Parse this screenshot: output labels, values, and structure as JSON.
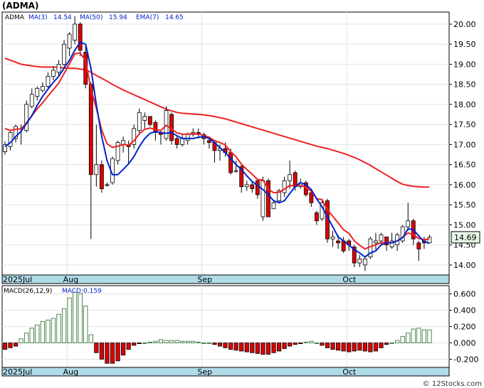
{
  "title": "(ADMA)",
  "watermark": "© 12Stocks.com",
  "price_panel": {
    "legend": {
      "symbol": "ADMA",
      "ma3_label": "MA(3)",
      "ma3_value": "14.54",
      "ma50_label": "MA(50)",
      "ma50_value": "15.94",
      "ema7_label": "EMA(7)",
      "ema7_value": "14.65"
    },
    "last_price_label": "14.69",
    "y_ticks": [
      "20.00",
      "19.50",
      "19.00",
      "18.50",
      "18.00",
      "17.50",
      "17.00",
      "16.50",
      "16.00",
      "15.50",
      "15.00",
      "14.50",
      "14.00"
    ],
    "x_labels": [
      "2025Jul",
      "Aug",
      "Sep",
      "Oct"
    ]
  },
  "macd_panel": {
    "legend": {
      "label": "MACD(26,12,9)",
      "value_label": "MACD:0.159"
    },
    "y_ticks": [
      "0.600",
      "0.400",
      "0.200",
      "0.000",
      "-0.200"
    ],
    "x_labels": [
      "2025Jul",
      "Aug",
      "Sep",
      "Oct"
    ]
  },
  "colors": {
    "up_candle": "#ffffff",
    "down_candle": "#dd0000",
    "ma_short": "#0022cc",
    "ma_long": "#ee2222",
    "macd_pos": "#ffffff",
    "macd_neg": "#dd0000",
    "axis_band": "#b0dbe8",
    "frame": "#000000"
  },
  "chart_data": [
    {
      "type": "candlestick",
      "ylim": [
        13.75,
        20.3
      ],
      "x_months": [
        "2025Jul",
        "Aug",
        "Sep",
        "Oct"
      ],
      "candles": [
        [
          16.82,
          17.0,
          16.75,
          17.08
        ],
        [
          16.95,
          17.3,
          16.85,
          17.35
        ],
        [
          17.15,
          17.45,
          17.05,
          17.5
        ],
        [
          17.4,
          17.4,
          17.0,
          17.5
        ],
        [
          17.35,
          18.0,
          17.3,
          18.1
        ],
        [
          17.95,
          18.25,
          17.9,
          18.4
        ],
        [
          18.2,
          18.4,
          18.1,
          18.45
        ],
        [
          18.35,
          18.45,
          18.3,
          18.55
        ],
        [
          18.45,
          18.7,
          18.4,
          18.8
        ],
        [
          18.7,
          18.85,
          18.6,
          18.95
        ],
        [
          18.8,
          19.0,
          18.7,
          19.1
        ],
        [
          19.0,
          19.5,
          18.95,
          19.6
        ],
        [
          19.4,
          19.75,
          19.2,
          19.8
        ],
        [
          19.6,
          20.0,
          19.5,
          20.2
        ],
        [
          20.0,
          19.35,
          19.2,
          20.05
        ],
        [
          19.3,
          18.5,
          18.4,
          19.5
        ],
        [
          18.5,
          16.25,
          14.65,
          18.55
        ],
        [
          16.25,
          16.5,
          15.95,
          17.5
        ],
        [
          16.5,
          15.9,
          15.8,
          16.6
        ],
        [
          16.0,
          16.0,
          15.95,
          16.05
        ],
        [
          16.05,
          16.65,
          16.0,
          16.7
        ],
        [
          16.6,
          17.05,
          16.5,
          17.1
        ],
        [
          17.0,
          17.1,
          16.8,
          17.2
        ],
        [
          17.0,
          16.95,
          16.5,
          17.1
        ],
        [
          17.0,
          17.4,
          16.9,
          17.5
        ],
        [
          17.35,
          17.8,
          17.25,
          17.9
        ],
        [
          17.6,
          17.7,
          17.4,
          17.8
        ],
        [
          17.7,
          17.5,
          17.45,
          17.6
        ],
        [
          17.55,
          17.3,
          17.1,
          17.6
        ],
        [
          17.3,
          17.25,
          17.0,
          17.35
        ],
        [
          17.15,
          17.85,
          17.1,
          17.95
        ],
        [
          17.75,
          17.1,
          17.0,
          17.8
        ],
        [
          17.15,
          17.0,
          16.9,
          17.2
        ],
        [
          17.0,
          17.15,
          16.95,
          17.25
        ],
        [
          17.1,
          17.25,
          17.0,
          17.3
        ],
        [
          17.25,
          17.3,
          17.2,
          17.4
        ],
        [
          17.3,
          17.25,
          17.15,
          17.4
        ],
        [
          17.25,
          17.15,
          17.0,
          17.3
        ],
        [
          17.1,
          17.05,
          16.9,
          17.2
        ],
        [
          17.05,
          16.85,
          16.55,
          17.1
        ],
        [
          16.85,
          16.9,
          16.6,
          17.0
        ],
        [
          16.9,
          16.8,
          16.7,
          17.05
        ],
        [
          16.8,
          16.3,
          16.25,
          16.9
        ],
        [
          16.35,
          16.35,
          16.3,
          16.6
        ],
        [
          16.45,
          15.95,
          15.8,
          16.5
        ],
        [
          15.95,
          16.0,
          15.85,
          16.1
        ],
        [
          16.0,
          15.9,
          15.8,
          16.1
        ],
        [
          16.1,
          15.75,
          15.65,
          16.15
        ],
        [
          15.2,
          16.1,
          15.1,
          16.2
        ],
        [
          16.1,
          15.2,
          15.2,
          16.15
        ],
        [
          15.4,
          15.55,
          15.4,
          15.6
        ],
        [
          15.6,
          15.85,
          15.55,
          15.9
        ],
        [
          15.8,
          16.1,
          15.7,
          16.2
        ],
        [
          16.1,
          16.25,
          15.9,
          16.6
        ],
        [
          16.3,
          15.95,
          15.85,
          16.35
        ],
        [
          15.95,
          16.05,
          15.9,
          16.15
        ],
        [
          16.05,
          15.75,
          15.7,
          16.1
        ],
        [
          15.8,
          15.55,
          15.45,
          15.9
        ],
        [
          15.3,
          15.1,
          15.0,
          15.35
        ],
        [
          15.15,
          15.55,
          15.1,
          15.65
        ],
        [
          15.6,
          14.65,
          14.55,
          15.65
        ],
        [
          14.65,
          14.7,
          14.45,
          14.85
        ],
        [
          14.6,
          14.55,
          14.4,
          14.75
        ],
        [
          14.6,
          14.35,
          14.3,
          14.7
        ],
        [
          14.6,
          14.5,
          14.35,
          14.65
        ],
        [
          14.45,
          14.05,
          13.95,
          14.5
        ],
        [
          14.05,
          14.15,
          13.95,
          14.25
        ],
        [
          14.0,
          14.15,
          13.85,
          14.2
        ],
        [
          14.2,
          14.65,
          14.15,
          14.7
        ],
        [
          14.55,
          14.6,
          14.35,
          14.8
        ],
        [
          14.6,
          14.75,
          14.5,
          14.8
        ],
        [
          14.7,
          14.5,
          14.35,
          14.7
        ],
        [
          14.45,
          14.6,
          14.4,
          14.8
        ],
        [
          14.5,
          14.75,
          14.35,
          14.8
        ],
        [
          14.6,
          14.95,
          14.55,
          15.0
        ],
        [
          14.95,
          15.1,
          14.85,
          15.55
        ],
        [
          15.1,
          14.65,
          14.5,
          15.15
        ],
        [
          14.55,
          14.4,
          14.1,
          14.6
        ],
        [
          14.6,
          14.55,
          14.4,
          14.7
        ],
        [
          14.55,
          14.69,
          14.55,
          14.75
        ]
      ],
      "ma_short": [
        16.95,
        17.05,
        17.2,
        17.33,
        17.52,
        17.72,
        17.98,
        18.2,
        18.38,
        18.55,
        18.7,
        18.9,
        19.1,
        19.35,
        19.55,
        19.5,
        18.9,
        18.0,
        17.2,
        16.6,
        16.25,
        16.25,
        16.38,
        16.52,
        16.7,
        16.95,
        17.15,
        17.28,
        17.32,
        17.3,
        17.28,
        17.3,
        17.22,
        17.15,
        17.15,
        17.15,
        17.18,
        17.2,
        17.15,
        17.05,
        16.92,
        16.8,
        16.65,
        16.5,
        16.38,
        16.22,
        16.08,
        15.98,
        15.88,
        15.75,
        15.6,
        15.55,
        15.6,
        15.78,
        15.95,
        16.05,
        16.0,
        15.88,
        15.65,
        15.45,
        15.2,
        14.95,
        14.7,
        14.6,
        14.5,
        14.38,
        14.3,
        14.2,
        14.3,
        14.35,
        14.5,
        14.55,
        14.55,
        14.6,
        14.68,
        14.9,
        14.88,
        14.72,
        14.58,
        14.54
      ],
      "ema_short": [
        17.4,
        17.35,
        17.38,
        17.39,
        17.54,
        17.72,
        17.89,
        18.04,
        18.21,
        18.37,
        18.53,
        18.77,
        19.01,
        19.26,
        19.28,
        19.09,
        18.38,
        17.91,
        17.36,
        17.02,
        16.93,
        16.96,
        17.0,
        16.99,
        17.09,
        17.27,
        17.38,
        17.41,
        17.38,
        17.35,
        17.48,
        17.39,
        17.29,
        17.26,
        17.26,
        17.27,
        17.26,
        17.23,
        17.18,
        17.1,
        17.05,
        16.99,
        16.82,
        16.7,
        16.51,
        16.38,
        16.26,
        16.13,
        16.12,
        15.89,
        15.8,
        15.81,
        15.89,
        15.98,
        15.97,
        15.99,
        15.93,
        15.84,
        15.65,
        15.63,
        15.38,
        15.21,
        15.05,
        14.88,
        14.79,
        14.6,
        14.49,
        14.4,
        14.46,
        14.5,
        14.56,
        14.55,
        14.56,
        14.6,
        14.69,
        14.8,
        14.75,
        14.66,
        14.63,
        14.65
      ],
      "ma_long": [
        19.15,
        19.1,
        19.05,
        19.0,
        18.98,
        18.96,
        18.94,
        18.93,
        18.93,
        18.93,
        18.92,
        18.91,
        18.9,
        18.9,
        18.88,
        18.86,
        18.8,
        18.72,
        18.65,
        18.58,
        18.5,
        18.43,
        18.36,
        18.3,
        18.24,
        18.18,
        18.12,
        18.06,
        18.0,
        17.94,
        17.88,
        17.84,
        17.8,
        17.78,
        17.77,
        17.76,
        17.75,
        17.74,
        17.72,
        17.7,
        17.67,
        17.64,
        17.6,
        17.56,
        17.52,
        17.48,
        17.44,
        17.4,
        17.36,
        17.32,
        17.28,
        17.24,
        17.2,
        17.16,
        17.12,
        17.08,
        17.04,
        17.0,
        16.96,
        16.93,
        16.9,
        16.86,
        16.82,
        16.78,
        16.73,
        16.68,
        16.62,
        16.55,
        16.48,
        16.4,
        16.32,
        16.24,
        16.16,
        16.08,
        16.01,
        15.98,
        15.96,
        15.95,
        15.94,
        15.94
      ]
    },
    {
      "type": "bar",
      "title": "MACD(26,12,9)",
      "ylim": [
        -0.3,
        0.7
      ],
      "values": [
        -0.08,
        -0.06,
        -0.04,
        0.05,
        0.12,
        0.18,
        0.22,
        0.26,
        0.28,
        0.3,
        0.35,
        0.42,
        0.55,
        0.62,
        0.6,
        0.45,
        0.1,
        -0.12,
        -0.2,
        -0.25,
        -0.25,
        -0.22,
        -0.15,
        -0.08,
        -0.03,
        -0.01,
        0.0,
        0.01,
        0.02,
        0.04,
        0.03,
        0.03,
        0.03,
        0.02,
        0.02,
        0.02,
        0.01,
        0.0,
        0.0,
        -0.02,
        -0.04,
        -0.06,
        -0.08,
        -0.09,
        -0.1,
        -0.11,
        -0.12,
        -0.13,
        -0.14,
        -0.14,
        -0.12,
        -0.1,
        -0.07,
        -0.04,
        -0.02,
        -0.01,
        0.01,
        0.02,
        0.0,
        -0.03,
        -0.06,
        -0.08,
        -0.09,
        -0.1,
        -0.11,
        -0.1,
        -0.09,
        -0.1,
        -0.11,
        -0.1,
        -0.06,
        -0.02,
        0.0,
        0.03,
        0.08,
        0.12,
        0.17,
        0.18,
        0.16,
        0.159
      ]
    }
  ]
}
